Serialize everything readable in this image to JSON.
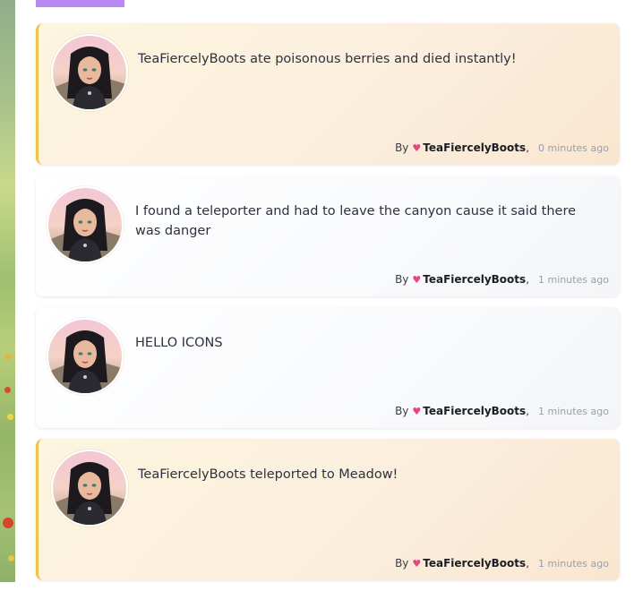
{
  "feed": {
    "items": [
      {
        "kind": "event",
        "message": "TeaFiercelyBoots ate poisonous berries and died instantly!",
        "by_label": "By",
        "user": "TeaFiercelyBoots",
        "separator": ",",
        "time": "0 minutes ago",
        "avatar_icon": "avatar-icon"
      },
      {
        "kind": "post",
        "message": "I found a teleporter and had to leave the canyon cause it said there was danger",
        "by_label": "By",
        "user": "TeaFiercelyBoots",
        "separator": ",",
        "time": "1 minutes ago",
        "avatar_icon": "avatar-icon"
      },
      {
        "kind": "post",
        "message": "HELLO ICONS",
        "by_label": "By",
        "user": "TeaFiercelyBoots",
        "separator": ",",
        "time": "1 minutes ago",
        "avatar_icon": "avatar-icon"
      },
      {
        "kind": "event",
        "message": "TeaFiercelyBoots teleported to Meadow!",
        "by_label": "By",
        "user": "TeaFiercelyBoots",
        "separator": ",",
        "time": "1 minutes ago",
        "avatar_icon": "avatar-icon"
      }
    ]
  },
  "icons": {
    "heart": "♥"
  },
  "colors": {
    "event_accent": "#f0c14b",
    "heart": "#e8457a",
    "tab": "#b889f0"
  }
}
